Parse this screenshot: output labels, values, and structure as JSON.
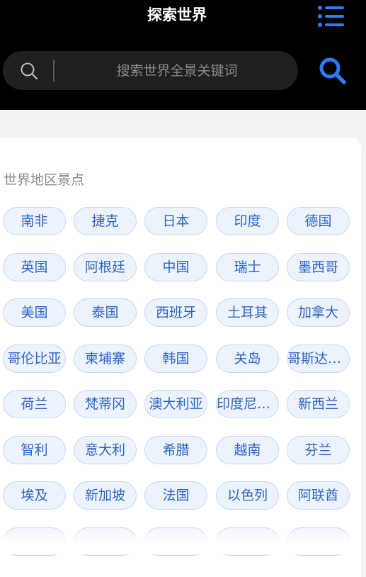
{
  "header": {
    "title": "探索世界",
    "menu_icon": "list-menu-icon",
    "accent_color": "#2f7cf6"
  },
  "search": {
    "placeholder": "搜索世界全景关键词",
    "icon": "search-icon"
  },
  "section": {
    "title": "世界地区景点"
  },
  "tags": [
    "南非",
    "捷克",
    "日本",
    "印度",
    "德国",
    "英国",
    "阿根廷",
    "中国",
    "瑞士",
    "墨西哥",
    "美国",
    "泰国",
    "西班牙",
    "土耳其",
    "加拿大",
    "哥伦比亚",
    "柬埔寨",
    "韩国",
    "关岛",
    "哥斯达黎加",
    "荷兰",
    "梵蒂冈",
    "澳大利亚",
    "印度尼西亚",
    "新西兰",
    "智利",
    "意大利",
    "希腊",
    "越南",
    "芬兰",
    "埃及",
    "新加坡",
    "法国",
    "以色列",
    "阿联酋"
  ]
}
